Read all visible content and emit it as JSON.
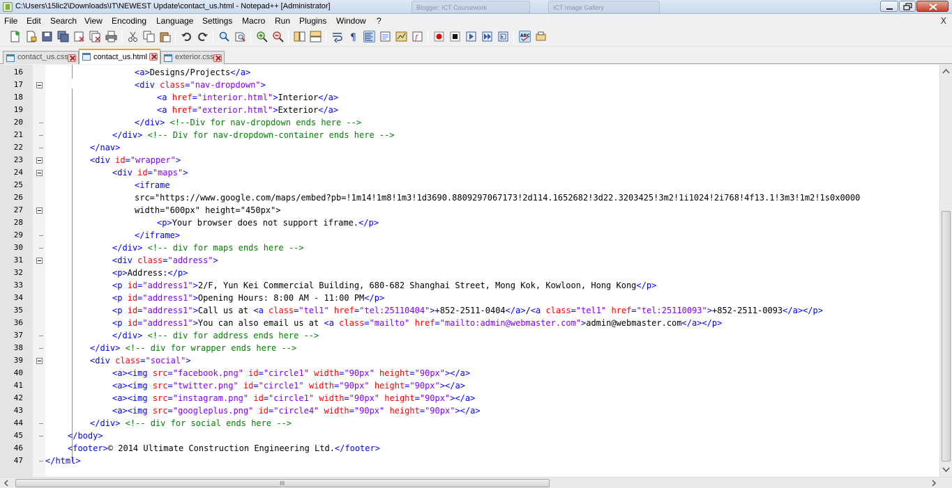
{
  "window": {
    "title": "C:\\Users\\15lic2\\Downloads\\IT\\NEWEST Update\\contact_us.html - Notepad++ [Administrator]",
    "background_tabs": [
      "Blogger: ICT Coursework",
      "ICT Image Gallery"
    ]
  },
  "menu": {
    "items": [
      "File",
      "Edit",
      "Search",
      "View",
      "Encoding",
      "Language",
      "Settings",
      "Macro",
      "Run",
      "Plugins",
      "Window",
      "?"
    ],
    "close_glyph": "X"
  },
  "tabs": [
    {
      "label": "contact_us.css",
      "active": false
    },
    {
      "label": "contact_us.html",
      "active": true
    },
    {
      "label": "exterior.css",
      "active": false
    }
  ],
  "editor": {
    "line_numbers": [
      "16",
      "17",
      "18",
      "19",
      "20",
      "21",
      "22",
      "23",
      "24",
      "25",
      "26",
      "27",
      "28",
      "29",
      "30",
      "31",
      "32",
      "33",
      "34",
      "35",
      "36",
      "37",
      "38",
      "39",
      "40",
      "41",
      "42",
      "43",
      "44",
      "45",
      "46",
      "47"
    ],
    "lines": [
      "<a>Designs/Projects</a>",
      "<div class=\"nav-dropdown\">",
      "<a href=\"interior.html\">Interior</a>",
      "<a href=\"exterior.html\">Exterior</a>",
      "</div> <!--Div for nav-dropdown ends here -->",
      "</div> <!-- Div for nav-dropdown-container ends here -->",
      "</nav>",
      "<div id=\"wrapper\">",
      "<div id=\"maps\">",
      "<iframe",
      "src=\"https://www.google.com/maps/embed?pb=!1m14!1m8!1m3!1d3690.8809297067173!2d114.1652682!3d22.3203425!3m2!1i1024!2i768!4f13.1!3m3!1m2!1s0x0000",
      "width=\"600px\" height=\"450px\">",
      "<p>Your browser does not support iframe.</p>",
      "</iframe>",
      "</div> <!-- div for maps ends here -->",
      "<div class=\"address\">",
      "<p>Address:</p>",
      "<p id=\"address1\">2/F, Yun Kei Commercial Building, 680-682 Shanghai Street, Mong Kok, Kowloon, Hong Kong</p>",
      "<p id=\"address1\">Opening Hours: 8:00 AM - 11:00 PM</p>",
      "<p id=\"address1\">Call us at <a class=\"tel1\" href=\"tel:25110404\">+852-2511-0404</a>/<a class=\"tel1\" href=\"tel:25110093\">+852-2511-0093</a></p>",
      "<p id=\"address1\">You can also email us at <a class=\"mailto\" href=\"mailto:admin@webmaster.com\">admin@webmaster.com</a></p>",
      "</div> <!-- div for address ends here -->",
      "</div> <!-- div for wrapper ends here -->",
      "<div class=\"social\">",
      "<a><img src=\"facebook.png\" id=\"circle1\" width=\"90px\" height=\"90px\"></a>",
      "<a><img src=\"twitter.png\" id=\"circle1\" width=\"90px\" height=\"90px\"></a>",
      "<a><img src=\"instagram.png\" id=\"circle1\" width=\"90px\" height=\"90px\"></a>",
      "<a><img src=\"googleplus.png\" id=\"circle4\" width=\"90px\" height=\"90px\"></a>",
      "</div> <!-- div for social ends here -->",
      "</body>",
      "<footer>© 2014 Ultimate Construction Engineering Ltd.</footer>",
      "</html>"
    ]
  },
  "scrollbar": {
    "grip_glyph": "III"
  },
  "colors": {
    "tag": "#0000ff",
    "attribute": "#ff0000",
    "value": "#8000ff",
    "comment": "#008000",
    "gutter": "#e4e4e4",
    "active_tab_accent": "#f5a300"
  }
}
